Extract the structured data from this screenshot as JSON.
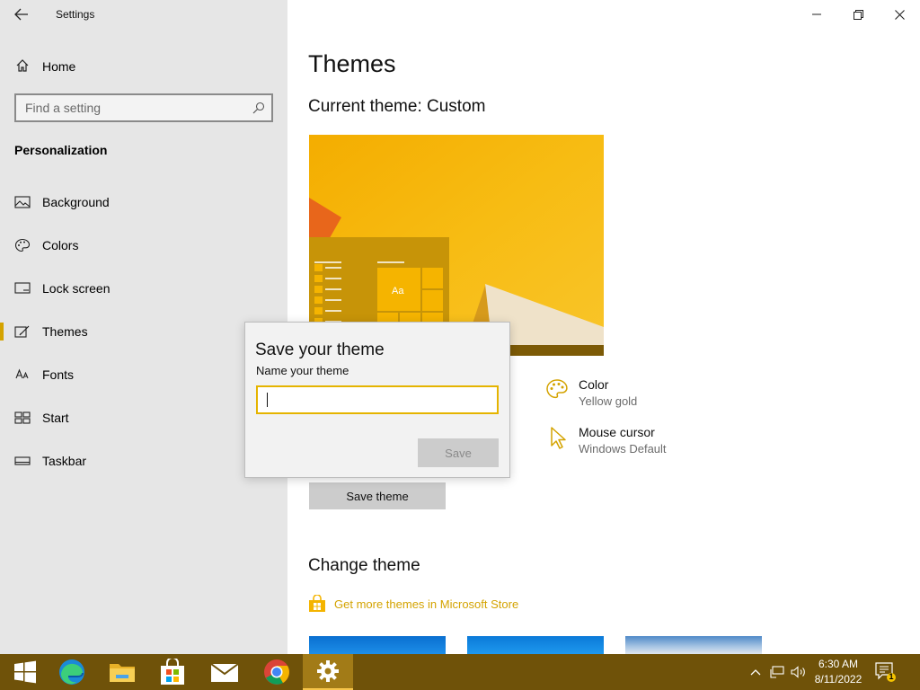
{
  "app": {
    "title": "Settings"
  },
  "sidebar": {
    "home_label": "Home",
    "search_placeholder": "Find a setting",
    "section_title": "Personalization",
    "items": [
      {
        "label": "Background",
        "icon": "picture-icon"
      },
      {
        "label": "Colors",
        "icon": "palette-icon"
      },
      {
        "label": "Lock screen",
        "icon": "lock-screen-icon"
      },
      {
        "label": "Themes",
        "icon": "themes-icon",
        "active": true
      },
      {
        "label": "Fonts",
        "icon": "fonts-icon"
      },
      {
        "label": "Start",
        "icon": "start-icon"
      },
      {
        "label": "Taskbar",
        "icon": "taskbar-icon"
      }
    ]
  },
  "main": {
    "page_title": "Themes",
    "current_theme": "Current theme: Custom",
    "properties": [
      {
        "title": "Color",
        "value": "Yellow gold",
        "icon": "palette-icon"
      },
      {
        "title": "Mouse cursor",
        "value": "Windows Default",
        "icon": "cursor-icon"
      }
    ],
    "save_theme_label": "Save theme",
    "change_theme_title": "Change theme",
    "store_link_label": "Get more themes in Microsoft Store",
    "preview_tile_label": "Aa"
  },
  "dialog": {
    "title": "Save your theme",
    "label": "Name your theme",
    "input_value": "",
    "save_label": "Save"
  },
  "taskbar": {
    "apps": [
      "start-icon",
      "edge-icon",
      "file-explorer-icon",
      "store-icon",
      "mail-icon",
      "chrome-icon",
      "settings-icon"
    ],
    "active_app": "settings-icon",
    "time": "6:30 AM",
    "date": "8/11/2022",
    "notification_count": "1"
  },
  "colors": {
    "accent": "#d4a300",
    "taskbar": "#6f5209",
    "sidebar_bg": "#e6e6e6",
    "dialog_input_border": "#e5b400"
  }
}
